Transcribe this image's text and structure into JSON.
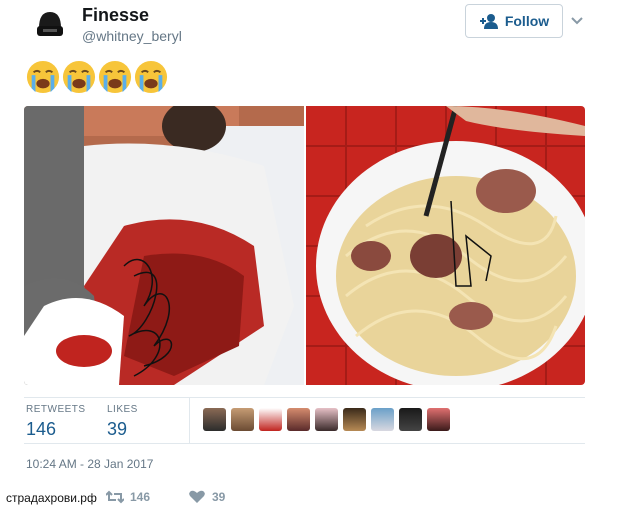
{
  "user": {
    "name": "Finesse",
    "handle": "@whitney_beryl"
  },
  "header": {
    "follow_label": "Follow"
  },
  "tweet": {
    "text_emoji": [
      "loudly-crying-face",
      "loudly-crying-face",
      "loudly-crying-face",
      "loudly-crying-face"
    ],
    "timestamp": "10:24 AM - 28 Jan 2017"
  },
  "stats": {
    "retweets_label": "RETWEETS",
    "retweets_count": "146",
    "likes_label": "LIKES",
    "likes_count": "39"
  },
  "actions": {
    "retweet_count": "146",
    "like_count": "39"
  },
  "watermark": "страдахрови.рф",
  "colors": {
    "link_blue": "#1b5c8e",
    "muted": "#657786",
    "border": "#e1e8ed"
  }
}
